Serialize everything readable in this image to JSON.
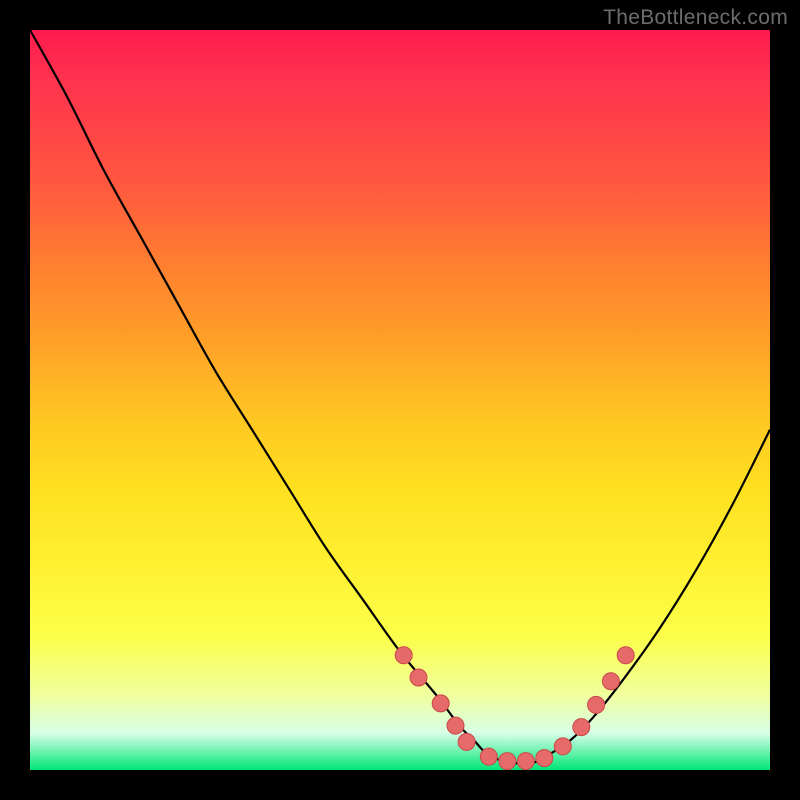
{
  "watermark": "TheBottleneck.com",
  "colors": {
    "background": "#000000",
    "curve": "#000000",
    "dot_fill": "#e66a6a",
    "dot_stroke": "#c94848"
  },
  "chart_data": {
    "type": "line",
    "title": "",
    "xlabel": "",
    "ylabel": "",
    "xlim": [
      0,
      100
    ],
    "ylim": [
      0,
      100
    ],
    "series": [
      {
        "name": "bottleneck-curve",
        "x": [
          0,
          5,
          10,
          15,
          20,
          25,
          30,
          35,
          40,
          45,
          50,
          55,
          58,
          60,
          62,
          65,
          68,
          70,
          73,
          76,
          80,
          85,
          90,
          95,
          100
        ],
        "y": [
          100,
          91,
          81,
          72,
          63,
          54,
          46,
          38,
          30,
          23,
          16,
          10,
          6,
          4,
          2,
          1,
          1,
          2,
          4,
          7,
          12,
          19,
          27,
          36,
          46
        ]
      }
    ],
    "highlight_points": {
      "name": "low-bottleneck-dots",
      "x": [
        50.5,
        52.5,
        55.5,
        57.5,
        59,
        62,
        64.5,
        67,
        69.5,
        72,
        74.5,
        76.5,
        78.5,
        80.5
      ],
      "y": [
        15.5,
        12.5,
        9,
        6,
        3.8,
        1.8,
        1.2,
        1.2,
        1.6,
        3.2,
        5.8,
        8.8,
        12,
        15.5
      ]
    }
  }
}
